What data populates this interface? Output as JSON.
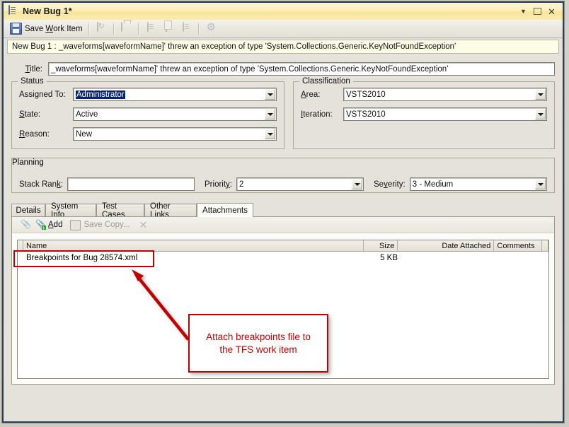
{
  "window": {
    "title": "New Bug 1*",
    "icon": "document-icon",
    "buttons": {
      "dropdown": "▼",
      "restore": "restore",
      "close": "✕"
    }
  },
  "toolbar": {
    "save_label_pre": "Save ",
    "save_label_accel": "W",
    "save_label_post": "ork Item",
    "save_full": "Save Work Item",
    "icons": [
      "refresh-icon",
      "print-icon",
      "link-icon",
      "copy-icon",
      "paste-icon",
      "settings-icon"
    ]
  },
  "infobar": {
    "text": "New Bug 1 : _waveforms[waveformName]' threw an exception of type 'System.Collections.Generic.KeyNotFoundException'"
  },
  "form": {
    "title_label": "Title:",
    "title_value": "_waveforms[waveformName]' threw an exception of type 'System.Collections.Generic.KeyNotFoundException'",
    "status": {
      "legend": "Status",
      "fields": [
        {
          "label": "Assigned To:",
          "value": "Administrator",
          "selected": true
        },
        {
          "label": "State:",
          "value": "Active",
          "selected": false
        },
        {
          "label": "Reason:",
          "value": "New",
          "selected": false
        }
      ]
    },
    "classification": {
      "legend": "Classification",
      "fields": [
        {
          "label": "Area:",
          "value": "VSTS2010"
        },
        {
          "label": "Iteration:",
          "value": "VSTS2010"
        }
      ]
    },
    "planning": {
      "legend": "Planning",
      "stack_rank_label": "Stack Rank:",
      "stack_rank_value": "",
      "priority_label": "Priority:",
      "priority_value": "2",
      "severity_label": "Severity:",
      "severity_value": "3 - Medium"
    }
  },
  "tabs": {
    "items": [
      "Details",
      "System Info",
      "Test Cases",
      "Other Links",
      "Attachments"
    ],
    "active": "Attachments"
  },
  "attachments": {
    "toolbar": {
      "add_label": "Add",
      "save_copy_label": "Save Copy...",
      "close_label": "✕"
    },
    "columns": [
      "Name",
      "",
      "Size",
      "",
      "Date Attached",
      "Comments",
      ""
    ],
    "rows": [
      {
        "name": "Breakpoints for Bug 28574.xml",
        "size": "5 KB",
        "date_attached": "",
        "comments": ""
      }
    ]
  },
  "annotation": {
    "callout_text_line1": "Attach breakpoints file to",
    "callout_text_line2": "the TFS work item",
    "color": "#c00000"
  }
}
